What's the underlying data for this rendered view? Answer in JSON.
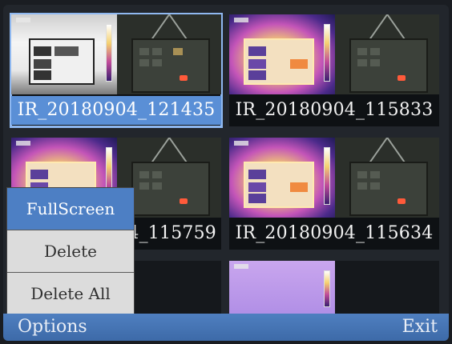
{
  "thumbnails": [
    {
      "label": "IR_20180904_121435",
      "selected": true
    },
    {
      "label": "IR_20180904_115833",
      "selected": false
    },
    {
      "label": "IR_20180904_115759",
      "selected": false,
      "visible_label": "4_115759"
    },
    {
      "label": "IR_20180904_115634",
      "selected": false
    },
    {
      "label": "",
      "selected": false
    },
    {
      "label": "",
      "selected": false
    }
  ],
  "menu": {
    "items": [
      {
        "label": "FullScreen",
        "active": true
      },
      {
        "label": "Delete",
        "active": false
      },
      {
        "label": "Delete All",
        "active": false
      }
    ]
  },
  "bottombar": {
    "left_label": "Options",
    "right_label": "Exit"
  },
  "colors": {
    "accent": "#4d7fc4",
    "bar": "#3d6aa8",
    "selection_outline": "#8fb8f0"
  }
}
